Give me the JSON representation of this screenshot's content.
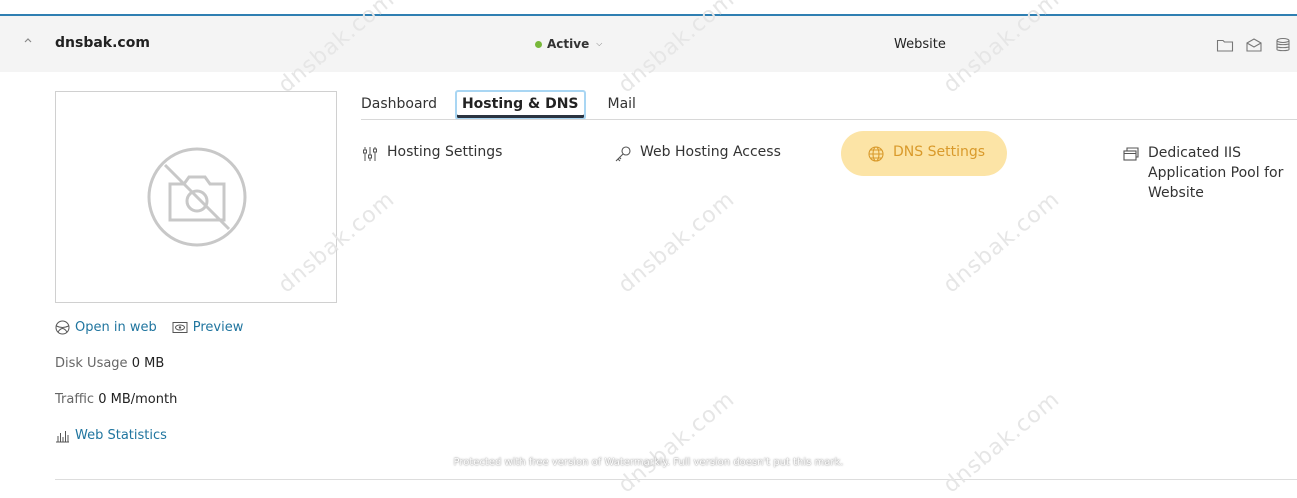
{
  "header": {
    "domain": "dnsbak.com",
    "status": "Active",
    "site_type": "Website",
    "icons": [
      "folder-icon",
      "mail-icon",
      "database-icon"
    ]
  },
  "preview": {
    "open_in_web": "Open in web",
    "preview_label": "Preview",
    "disk_usage_label": "Disk Usage",
    "disk_usage_value": "0 MB",
    "traffic_label": "Traffic",
    "traffic_value": "0 MB/month",
    "web_statistics": "Web Statistics"
  },
  "tabs": [
    {
      "label": "Dashboard",
      "active": false
    },
    {
      "label": "Hosting & DNS",
      "active": true
    },
    {
      "label": "Mail",
      "active": false
    }
  ],
  "tools": [
    {
      "label": "Hosting Settings",
      "icon": "sliders-icon"
    },
    {
      "label": "Web Hosting Access",
      "icon": "key-icon"
    },
    {
      "label": "DNS Settings",
      "icon": "globe-icon",
      "highlighted": true
    },
    {
      "label": "Dedicated IIS Application Pool for Website",
      "icon": "windows-icon"
    }
  ],
  "watermark": {
    "text": "dnsbak.com",
    "footer": "Protected with free version of Watermarkly. Full version doesn't put this mark."
  },
  "colors": {
    "accent": "#2f7fb2",
    "link": "#20759f",
    "status_active": "#78b83a",
    "highlight_bg": "#fce4a6",
    "highlight_text": "#d99a2b"
  }
}
